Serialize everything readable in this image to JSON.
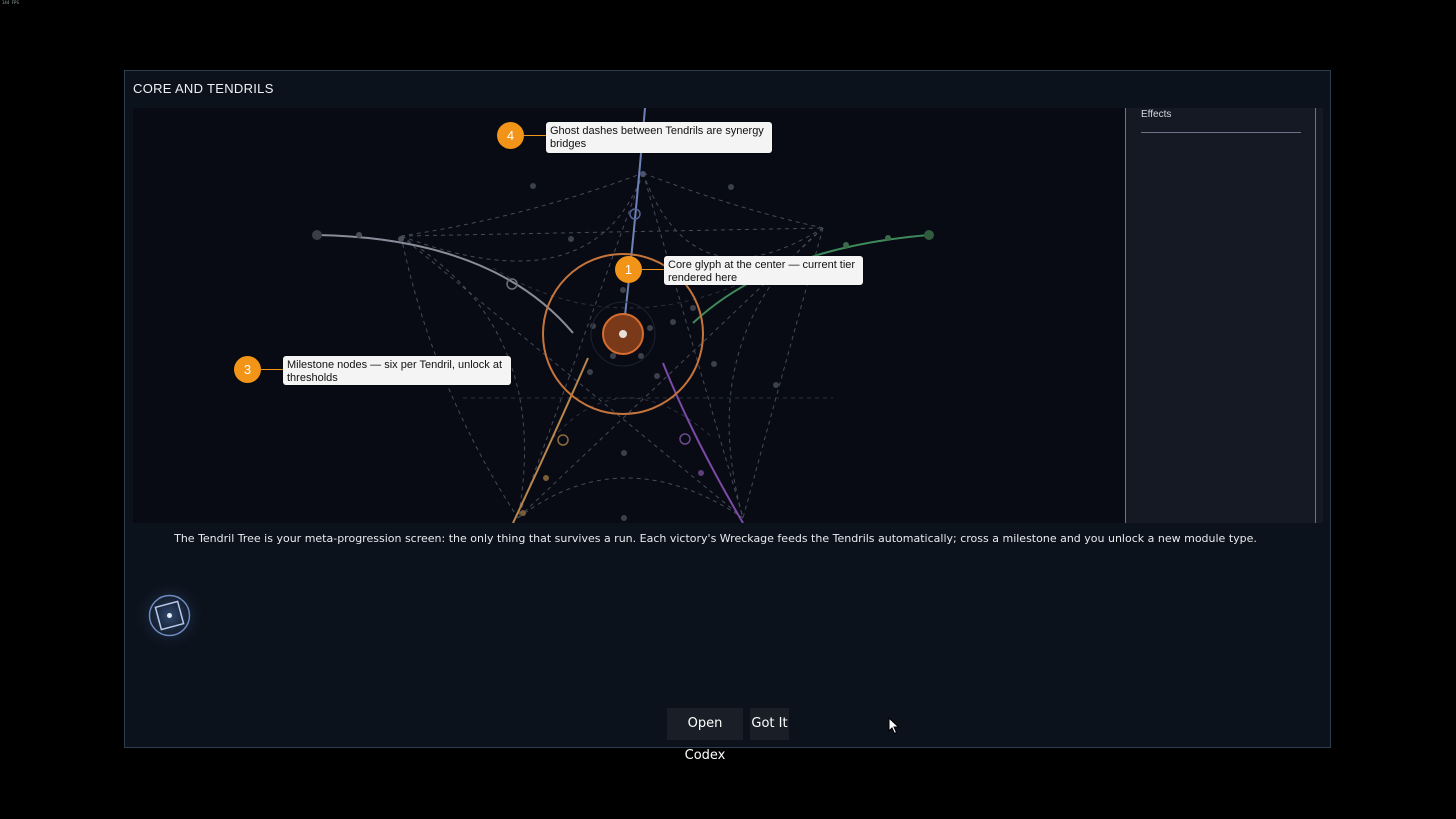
{
  "hud": {
    "fps": "144 FPS"
  },
  "dialog": {
    "title": "CORE AND TENDRILS",
    "side_panel": {
      "label": "Effects"
    },
    "description": "The Tendril Tree is your meta-progression screen: the only thing that survives a run. Each victory's Wreckage feeds the Tendrils automatically; cross a milestone and you unlock a new module type.",
    "buttons": {
      "open_codex": "Open Codex",
      "got_it": "Got It"
    }
  },
  "callouts": [
    {
      "number": "4",
      "text": "Ghost dashes between Tendrils are synergy bridges"
    },
    {
      "number": "1",
      "text": "Core glyph at the center — current tier rendered here"
    },
    {
      "number": "3",
      "text": "Milestone nodes — six per Tendril, unlock at thresholds"
    }
  ],
  "tree": {
    "tendril_colors": {
      "top": "#6f82b8",
      "left": "#8a8d99",
      "right": "#3f8a5a",
      "bottom_left": "#b9874c",
      "bottom_right": "#7d4aa6"
    },
    "core_color": "#c8662c",
    "ring_color": "#c5753c"
  },
  "colors": {
    "accent": "#f29418",
    "dialog_bg": "#0c121c",
    "viewport_bg": "#080b14"
  }
}
